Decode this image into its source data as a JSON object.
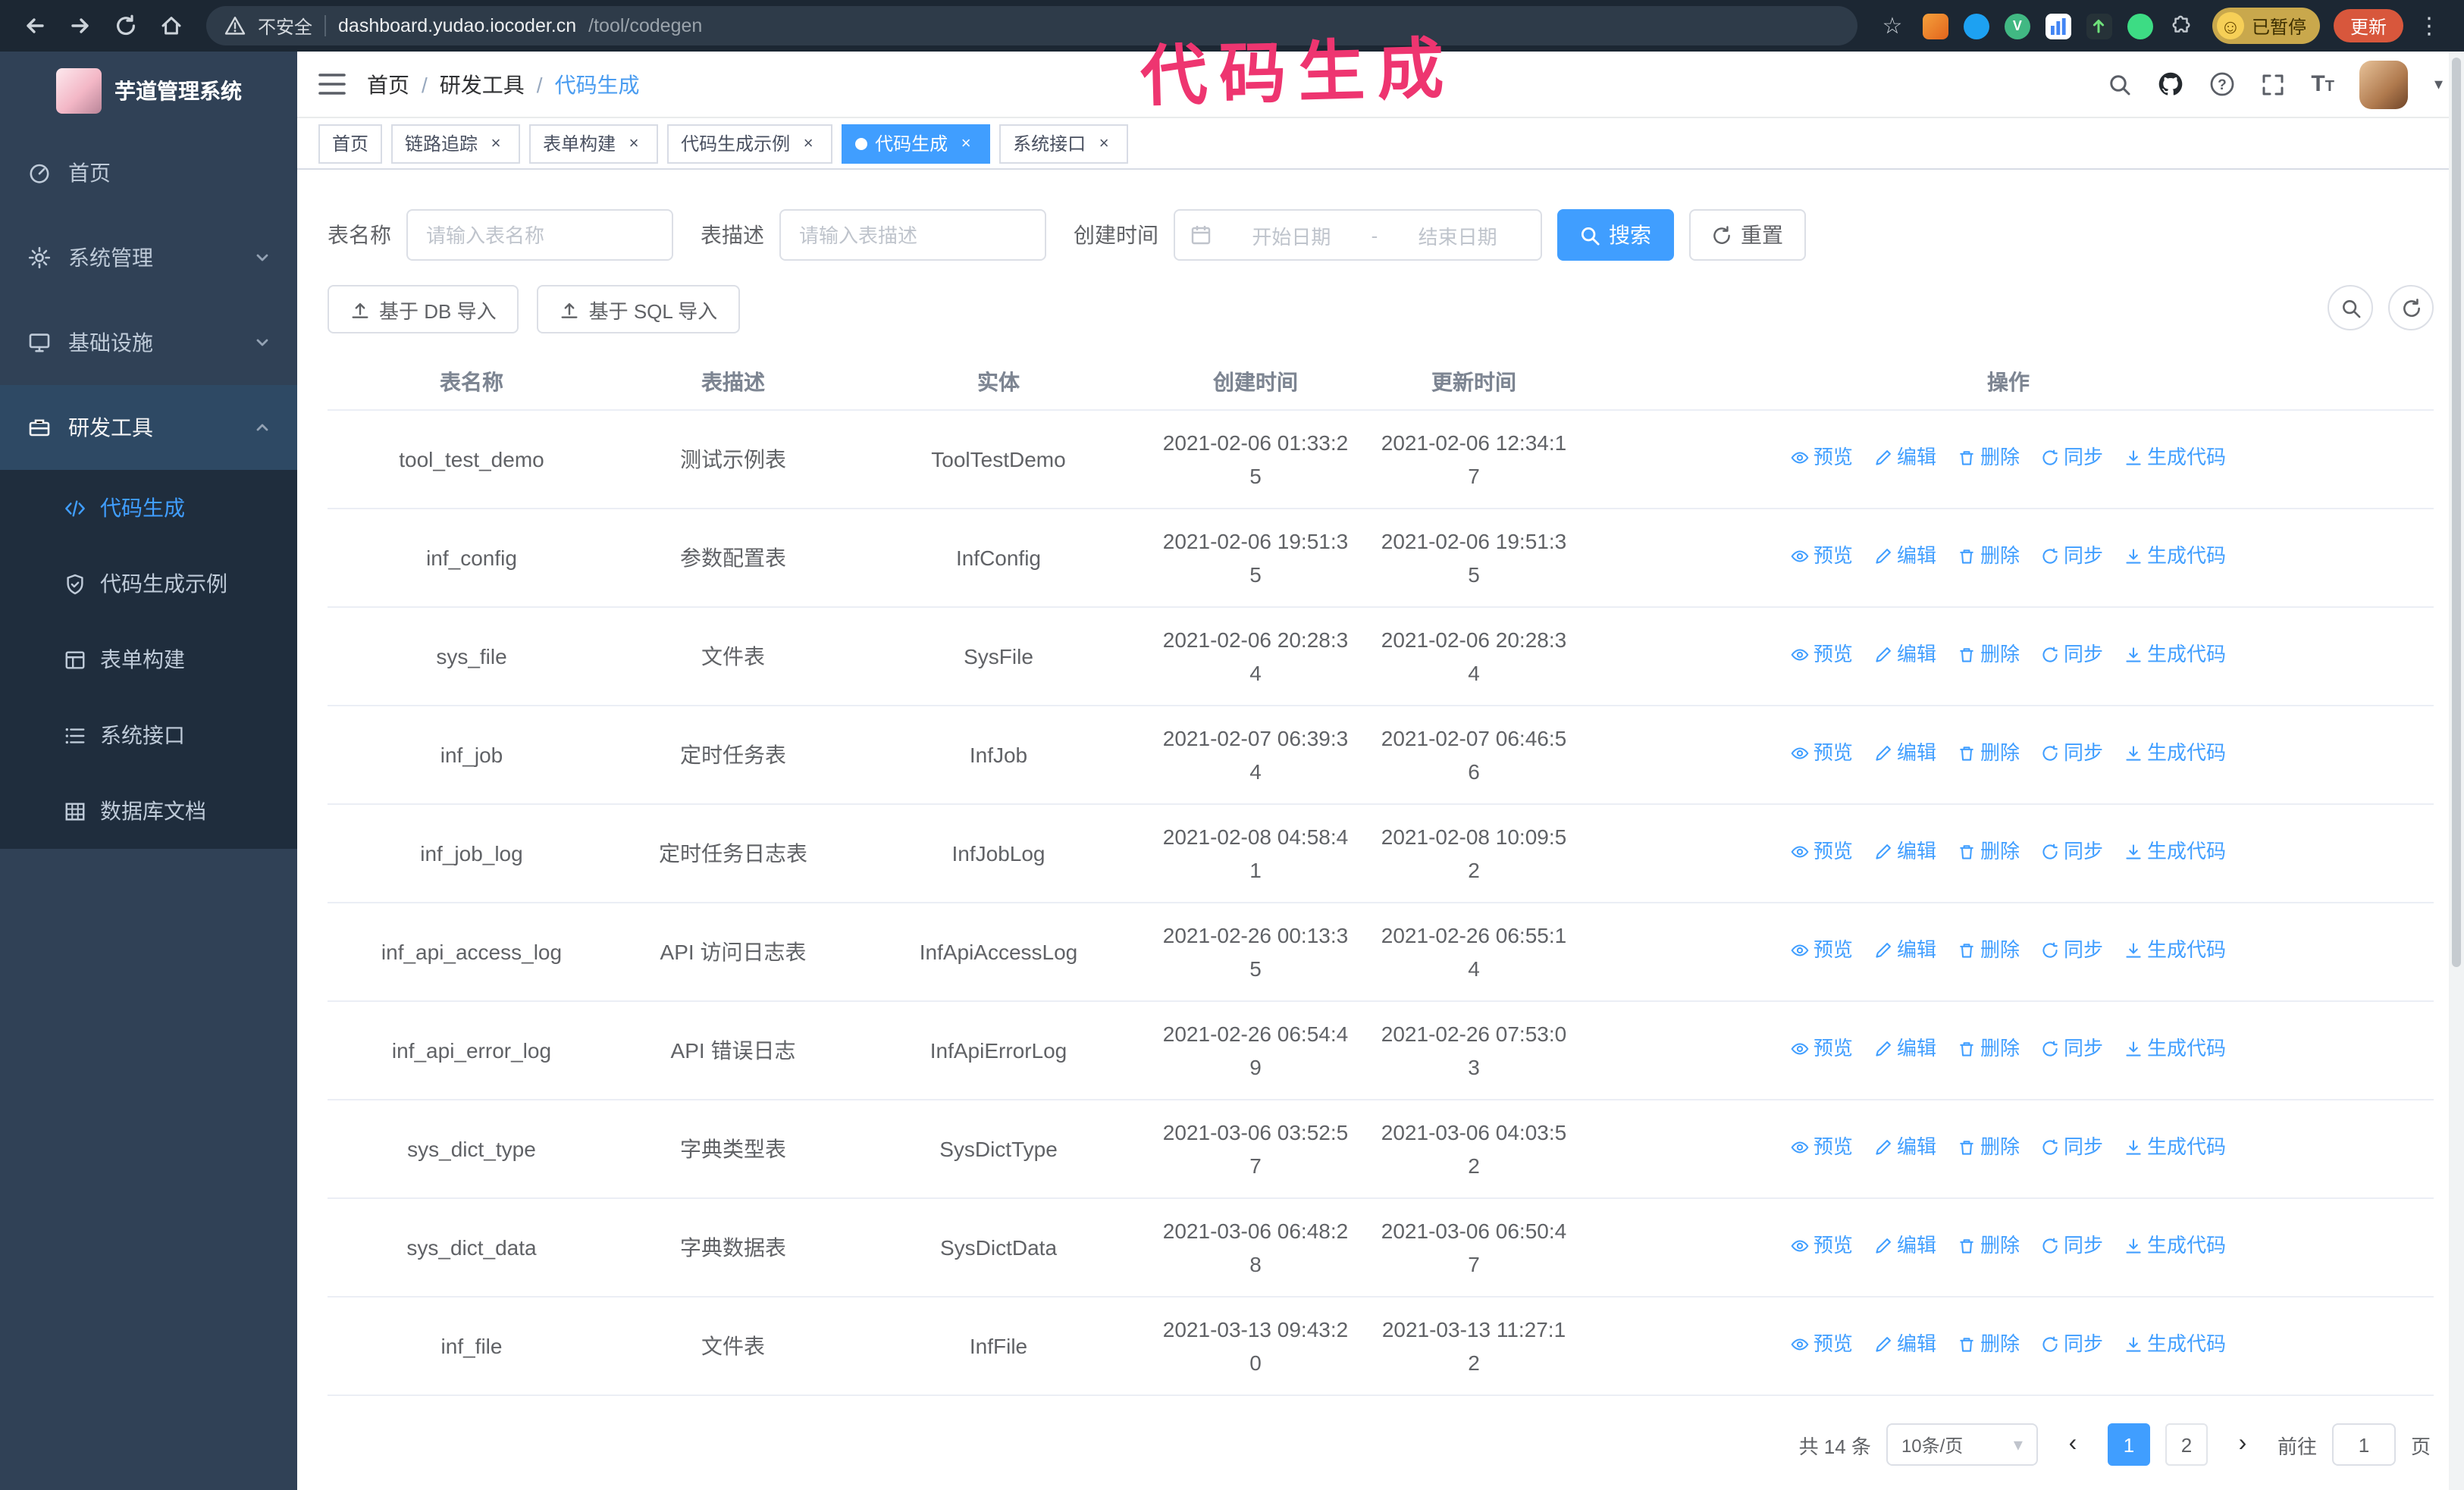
{
  "icons": {
    "star": "☆",
    "kebab": "⋮",
    "smiley": "☺",
    "prev": "‹",
    "next": "›",
    "caret_down": "▾",
    "text_size_large": "T",
    "text_size_small": "T"
  },
  "annotation": {
    "text": "代码生成"
  },
  "browser": {
    "security_label": "不安全",
    "url_host": "dashboard.yudao.iocoder.cn",
    "url_path": "/tool/codegen",
    "profile_badge": "已暂停",
    "update_button": "更新"
  },
  "sidebar": {
    "logo_title": "芋道管理系统",
    "items": [
      {
        "label": "首页"
      },
      {
        "label": "系统管理"
      },
      {
        "label": "基础设施"
      },
      {
        "label": "研发工具"
      }
    ],
    "sub_items": [
      {
        "label": "代码生成"
      },
      {
        "label": "代码生成示例"
      },
      {
        "label": "表单构建"
      },
      {
        "label": "系统接口"
      },
      {
        "label": "数据库文档"
      }
    ]
  },
  "header": {
    "breadcrumb": [
      "首页",
      "研发工具",
      "代码生成"
    ],
    "breadcrumb_separator": "/"
  },
  "tags": [
    {
      "label": "首页"
    },
    {
      "label": "链路追踪"
    },
    {
      "label": "表单构建"
    },
    {
      "label": "代码生成示例"
    },
    {
      "label": "代码生成"
    },
    {
      "label": "系统接口"
    }
  ],
  "filters": {
    "table_name_label": "表名称",
    "table_name_placeholder": "请输入表名称",
    "table_desc_label": "表描述",
    "table_desc_placeholder": "请输入表描述",
    "create_time_label": "创建时间",
    "date_start_placeholder": "开始日期",
    "date_separator": "-",
    "date_end_placeholder": "结束日期",
    "search_button": "搜索",
    "reset_button": "重置"
  },
  "toolbar": {
    "import_db_button": "基于 DB 导入",
    "import_sql_button": "基于 SQL 导入"
  },
  "table": {
    "columns": [
      "表名称",
      "表描述",
      "实体",
      "创建时间",
      "更新时间",
      "操作"
    ],
    "actions": [
      "预览",
      "编辑",
      "删除",
      "同步",
      "生成代码"
    ],
    "rows": [
      {
        "name": "tool_test_demo",
        "desc": "测试示例表",
        "entity": "ToolTestDemo",
        "created": "2021-02-06 01:33:25",
        "updated": "2021-02-06 12:34:17"
      },
      {
        "name": "inf_config",
        "desc": "参数配置表",
        "entity": "InfConfig",
        "created": "2021-02-06 19:51:35",
        "updated": "2021-02-06 19:51:35"
      },
      {
        "name": "sys_file",
        "desc": "文件表",
        "entity": "SysFile",
        "created": "2021-02-06 20:28:34",
        "updated": "2021-02-06 20:28:34"
      },
      {
        "name": "inf_job",
        "desc": "定时任务表",
        "entity": "InfJob",
        "created": "2021-02-07 06:39:34",
        "updated": "2021-02-07 06:46:56"
      },
      {
        "name": "inf_job_log",
        "desc": "定时任务日志表",
        "entity": "InfJobLog",
        "created": "2021-02-08 04:58:41",
        "updated": "2021-02-08 10:09:52"
      },
      {
        "name": "inf_api_access_log",
        "desc": "API 访问日志表",
        "entity": "InfApiAccessLog",
        "created": "2021-02-26 00:13:35",
        "updated": "2021-02-26 06:55:14"
      },
      {
        "name": "inf_api_error_log",
        "desc": "API 错误日志",
        "entity": "InfApiErrorLog",
        "created": "2021-02-26 06:54:49",
        "updated": "2021-02-26 07:53:03"
      },
      {
        "name": "sys_dict_type",
        "desc": "字典类型表",
        "entity": "SysDictType",
        "created": "2021-03-06 03:52:57",
        "updated": "2021-03-06 04:03:52"
      },
      {
        "name": "sys_dict_data",
        "desc": "字典数据表",
        "entity": "SysDictData",
        "created": "2021-03-06 06:48:28",
        "updated": "2021-03-06 06:50:47"
      },
      {
        "name": "inf_file",
        "desc": "文件表",
        "entity": "InfFile",
        "created": "2021-03-13 09:43:20",
        "updated": "2021-03-13 11:27:12"
      }
    ]
  },
  "pagination": {
    "total": "共 14 条",
    "page_size": "10条/页",
    "pages": [
      "1",
      "2"
    ],
    "goto_label": "前往",
    "goto_value": "1",
    "goto_suffix": "页"
  }
}
